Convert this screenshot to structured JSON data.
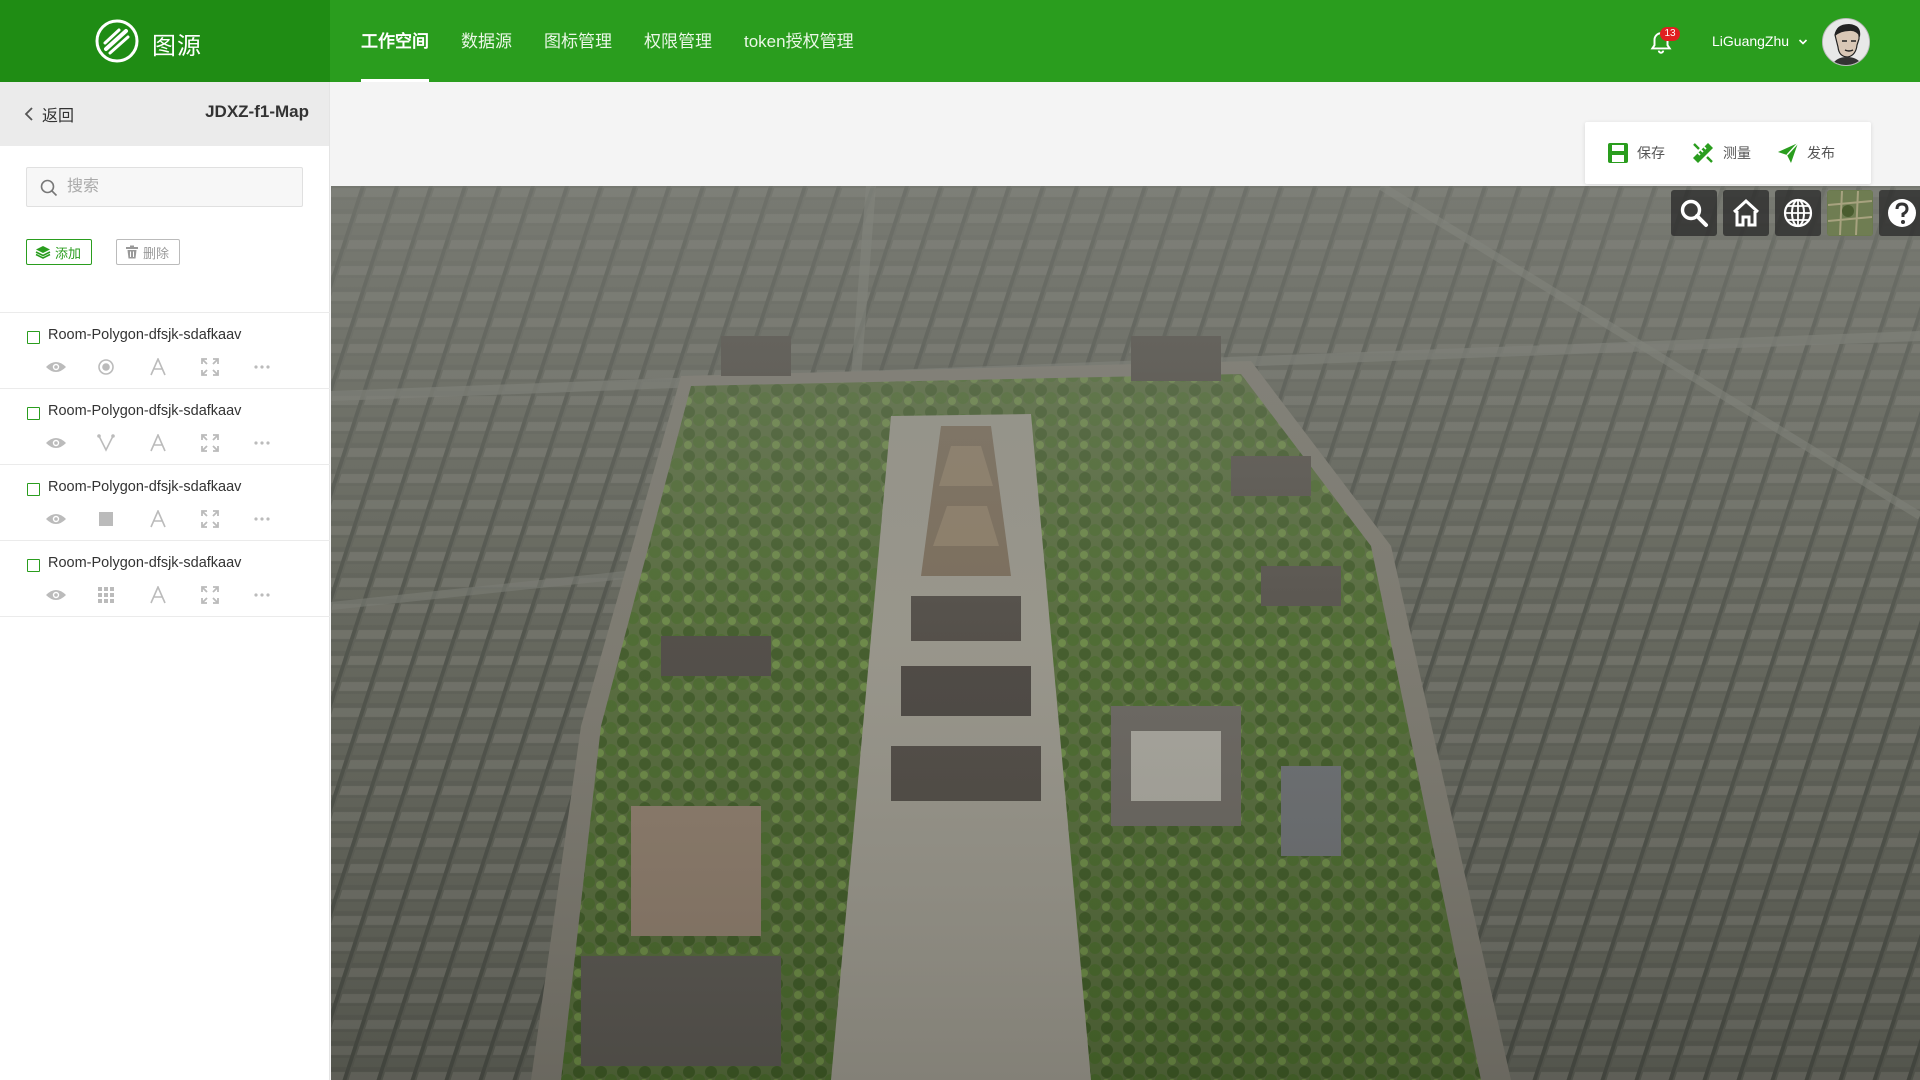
{
  "app": {
    "name": "图源"
  },
  "nav": {
    "items": [
      {
        "label": "工作空间",
        "active": true
      },
      {
        "label": "数据源",
        "active": false
      },
      {
        "label": "图标管理",
        "active": false
      },
      {
        "label": "权限管理",
        "active": false
      },
      {
        "label": "token授权管理",
        "active": false
      }
    ]
  },
  "user": {
    "notifications": "13",
    "name": "LiGuangZhu"
  },
  "sidebar": {
    "back_label": "返回",
    "map_title": "JDXZ-f1-Map",
    "search_placeholder": "搜索",
    "add_label": "添加",
    "delete_label": "删除",
    "layers": [
      {
        "name": "Room-Polygon-dfsjk-sdafkaav",
        "style_icon": "point-icon"
      },
      {
        "name": "Room-Polygon-dfsjk-sdafkaav",
        "style_icon": "line-icon"
      },
      {
        "name": "Room-Polygon-dfsjk-sdafkaav",
        "style_icon": "fill-icon"
      },
      {
        "name": "Room-Polygon-dfsjk-sdafkaav",
        "style_icon": "grid-icon"
      }
    ]
  },
  "toolbar": {
    "save_label": "保存",
    "measure_label": "测量",
    "publish_label": "发布"
  },
  "map_tools": [
    "search-icon",
    "home-icon",
    "globe-icon",
    "basemap-icon",
    "help-icon"
  ],
  "colors": {
    "brand": "#2a9d1e",
    "brand_dark": "#1f8c14",
    "badge": "#e02020"
  }
}
